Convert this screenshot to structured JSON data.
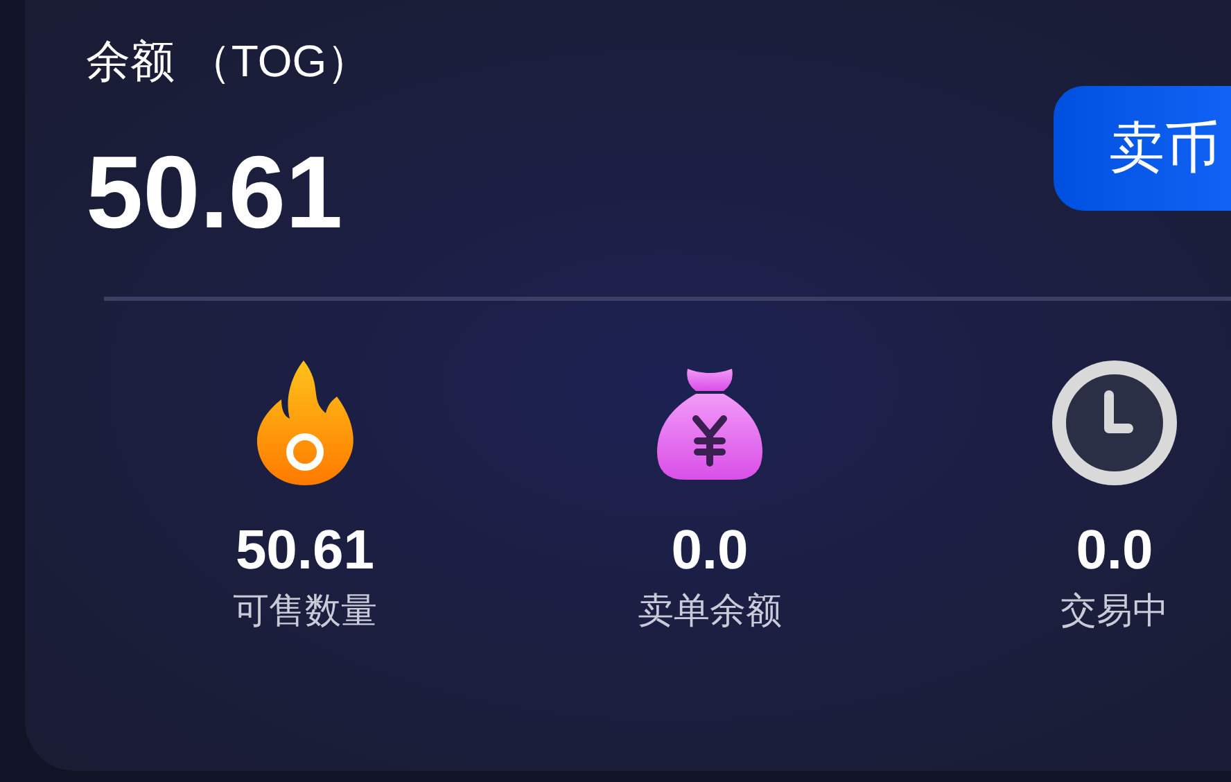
{
  "balance": {
    "label": "余额 （TOG）",
    "amount": "50.61"
  },
  "sell_button": {
    "label": "卖币"
  },
  "stats": [
    {
      "kind": "flame",
      "value": "50.61",
      "label": "可售数量"
    },
    {
      "kind": "bag",
      "value": "0.0",
      "label": "卖单余额"
    },
    {
      "kind": "clock",
      "value": "0.0",
      "label": "交易中"
    }
  ]
}
